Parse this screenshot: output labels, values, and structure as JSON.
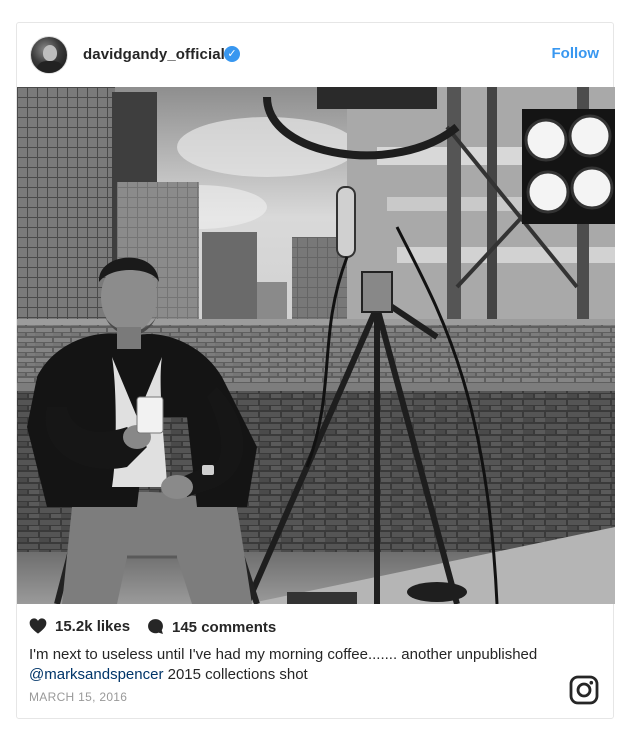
{
  "post": {
    "username": "davidgandy_official",
    "verified_mark": "✓",
    "follow_label": "Follow",
    "photo_description": "",
    "likes": "15.2k likes",
    "comments": "145 comments",
    "caption_text": "I'm next to useless until I've had my morning coffee....... another unpublished ",
    "caption_mention": "@marksandspencer",
    "caption_tail": " 2015 collections shot",
    "date": "MARCH 15, 2016"
  },
  "icons": {
    "avatar": "avatar",
    "verified": "verified-badge-icon",
    "heart": "heart-icon",
    "comment": "comment-bubble-icon",
    "instagram": "instagram-logo-icon"
  },
  "colors": {
    "accent": "#3897f0",
    "mention": "#003569",
    "text": "#262626",
    "muted": "#999999"
  }
}
